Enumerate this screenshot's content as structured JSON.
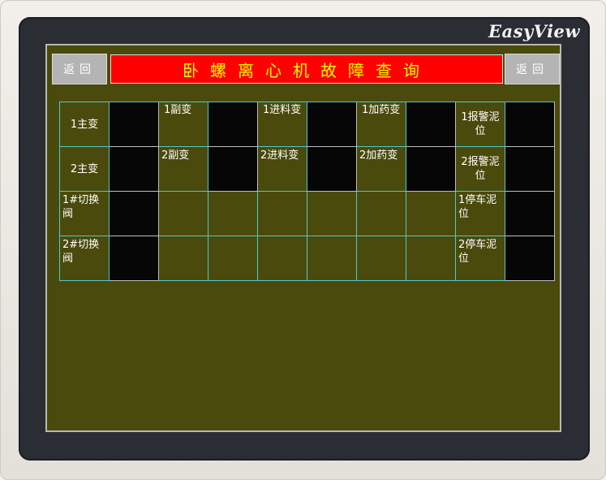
{
  "brand": "EasyView",
  "header": {
    "back_left": "返回",
    "title": "卧螺离心机故障查询",
    "back_right": "返回"
  },
  "grid": {
    "r1": [
      "1主变",
      "1副变",
      "1进料变",
      "1加药变",
      "1报警泥位"
    ],
    "r2": [
      "2主变",
      "2副变",
      "2进料变",
      "2加药变",
      "2报警泥位"
    ],
    "r3": [
      "1#切换阀",
      "1停车泥位"
    ],
    "r4": [
      "2#切换阀",
      "2停车泥位"
    ]
  },
  "colors": {
    "screen_bg": "#4a4a0c",
    "title_bg": "#ff0000",
    "title_text": "#ffff00",
    "grid_line": "#52c8c8",
    "indicator_off": "#060606"
  }
}
